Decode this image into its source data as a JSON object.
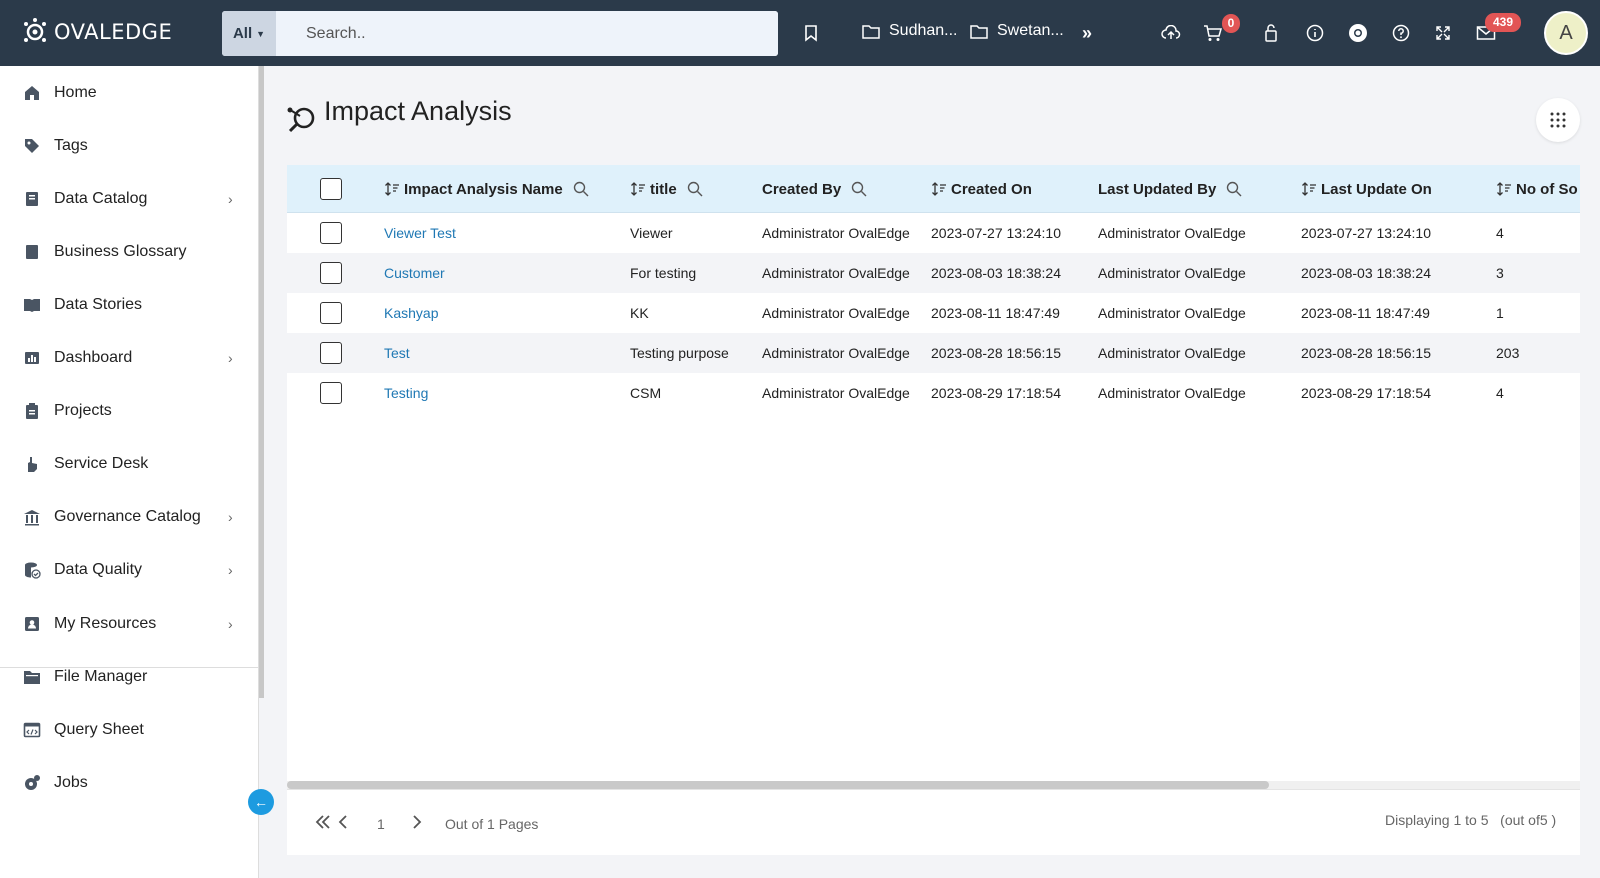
{
  "topbar": {
    "logo": "OVALEDGE",
    "search_scope": "All",
    "search_placeholder": "Search..",
    "folders": [
      "Sudhan...",
      "Swetan..."
    ],
    "cart_count": "0",
    "mail_count": "439",
    "avatar_initial": "A"
  },
  "sidebar": {
    "items": [
      {
        "label": "Home",
        "icon": "home-icon",
        "chevron": false
      },
      {
        "label": "Tags",
        "icon": "tag-icon",
        "chevron": false
      },
      {
        "label": "Data Catalog",
        "icon": "data-catalog-icon",
        "chevron": true
      },
      {
        "label": "Business Glossary",
        "icon": "book-icon",
        "chevron": false
      },
      {
        "label": "Data Stories",
        "icon": "open-book-icon",
        "chevron": false
      },
      {
        "label": "Dashboard",
        "icon": "dashboard-icon",
        "chevron": true
      },
      {
        "label": "Projects",
        "icon": "clipboard-icon",
        "chevron": false
      },
      {
        "label": "Service Desk",
        "icon": "hand-icon",
        "chevron": false
      },
      {
        "label": "Governance Catalog",
        "icon": "bank-icon",
        "chevron": true
      },
      {
        "label": "Data Quality",
        "icon": "database-check-icon",
        "chevron": true
      },
      {
        "label": "My Resources",
        "icon": "user-card-icon",
        "chevron": true
      },
      {
        "label": "File Manager",
        "icon": "folder-icon",
        "chevron": false
      },
      {
        "label": "Query Sheet",
        "icon": "code-icon",
        "chevron": false
      },
      {
        "label": "Jobs",
        "icon": "jobs-icon",
        "chevron": false
      }
    ]
  },
  "page": {
    "title": "Impact Analysis"
  },
  "table": {
    "columns": [
      "Impact Analysis Name",
      "title",
      "Created By",
      "Created On",
      "Last Updated By",
      "Last Update On",
      "No of So"
    ],
    "rows": [
      [
        "Viewer Test",
        "Viewer",
        "Administrator OvalEdge",
        "2023-07-27 13:24:10",
        "Administrator OvalEdge",
        "2023-07-27 13:24:10",
        "4"
      ],
      [
        "Customer",
        "For testing",
        "Administrator OvalEdge",
        "2023-08-03 18:38:24",
        "Administrator OvalEdge",
        "2023-08-03 18:38:24",
        "3"
      ],
      [
        "Kashyap",
        "KK",
        "Administrator OvalEdge",
        "2023-08-11 18:47:49",
        "Administrator OvalEdge",
        "2023-08-11 18:47:49",
        "1"
      ],
      [
        "Test",
        "Testing purpose",
        "Administrator OvalEdge",
        "2023-08-28 18:56:15",
        "Administrator OvalEdge",
        "2023-08-28 18:56:15",
        "203"
      ],
      [
        "Testing",
        "CSM",
        "Administrator OvalEdge",
        "2023-08-29 17:18:54",
        "Administrator OvalEdge",
        "2023-08-29 17:18:54",
        "4"
      ]
    ]
  },
  "pager": {
    "page": "1",
    "out_of": "Out of 1 Pages",
    "displaying": "Displaying 1 to 5   (out of5 )"
  }
}
